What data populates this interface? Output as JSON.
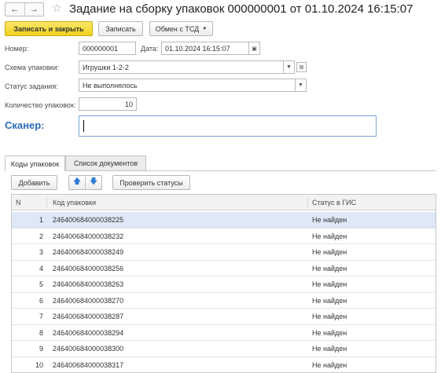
{
  "window": {
    "title": "Задание на сборку упаковок 000000001 от 01.10.2024 16:15:07"
  },
  "toolbar": {
    "save_close_label": "Записать и закрыть",
    "save_label": "Записать",
    "exchange_label": "Обмен с ТСД"
  },
  "form": {
    "number_label": "Номер:",
    "number_value": "000000001",
    "date_label": "Дата:",
    "date_value": "01.10.2024 16:15:07",
    "scheme_label": "Схема упаковки:",
    "scheme_value": "Игрушки 1-2-2",
    "status_label": "Статус задания:",
    "status_value": "Не выполнялось",
    "count_label": "Количество упаковок:",
    "count_value": "10",
    "scanner_label": "Сканер:"
  },
  "tabs": [
    {
      "label": "Коды упаковок"
    },
    {
      "label": "Список документов"
    }
  ],
  "table_toolbar": {
    "add_label": "Добавить",
    "check_label": "Проверить статусы"
  },
  "table": {
    "columns": [
      "N",
      "Код упаковки",
      "Статус в ГИС"
    ],
    "rows": [
      {
        "n": "1",
        "code": "246400684000038225",
        "status": "Не найден"
      },
      {
        "n": "2",
        "code": "246400684000038232",
        "status": "Не найден"
      },
      {
        "n": "3",
        "code": "246400684000038249",
        "status": "Не найден"
      },
      {
        "n": "4",
        "code": "246400684000038256",
        "status": "Не найден"
      },
      {
        "n": "5",
        "code": "246400684000038263",
        "status": "Не найден"
      },
      {
        "n": "6",
        "code": "246400684000038270",
        "status": "Не найден"
      },
      {
        "n": "7",
        "code": "246400684000038287",
        "status": "Не найден"
      },
      {
        "n": "8",
        "code": "246400684000038294",
        "status": "Не найден"
      },
      {
        "n": "9",
        "code": "246400684000038300",
        "status": "Не найден"
      },
      {
        "n": "10",
        "code": "246400684000038317",
        "status": "Не найден"
      }
    ]
  },
  "colors": {
    "primary_button": "#f1d21c",
    "scanner_label": "#2b6bb8",
    "selected_row": "#dfe8f6"
  }
}
